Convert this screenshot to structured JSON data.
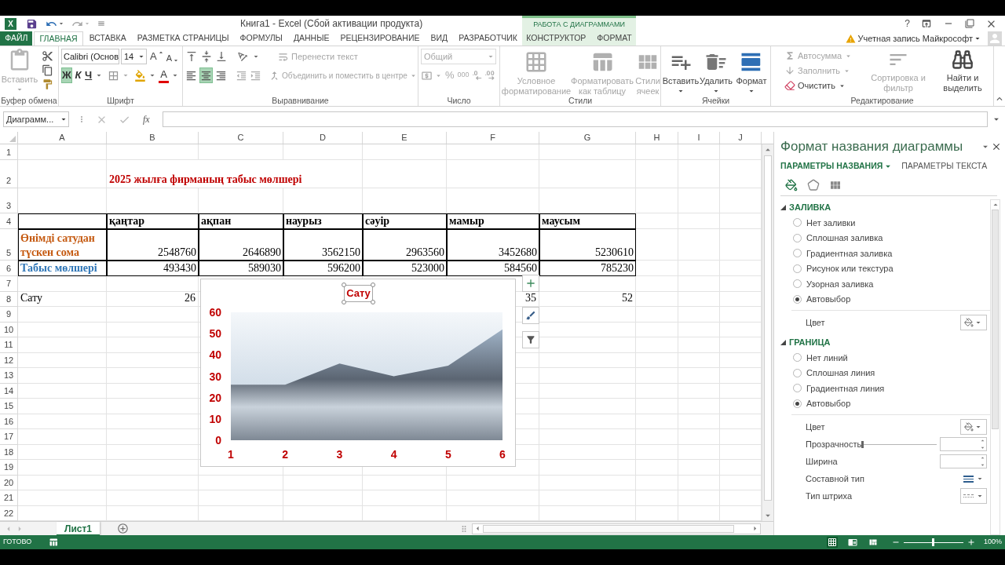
{
  "window": {
    "logo": "X",
    "title": "Книга1 - Excel (Сбой активации продукта)",
    "help": "?"
  },
  "context_group": {
    "label": "РАБОТА С ДИАГРАММАМИ"
  },
  "ribbon_tabs": [
    {
      "label": "ФАЙЛ",
      "kind": "file",
      "selected": false
    },
    {
      "label": "ГЛАВНАЯ",
      "kind": "main",
      "selected": true
    },
    {
      "label": "ВСТАВКА",
      "kind": "main",
      "selected": false
    },
    {
      "label": "РАЗМЕТКА СТРАНИЦЫ",
      "kind": "main",
      "selected": false
    },
    {
      "label": "ФОРМУЛЫ",
      "kind": "main",
      "selected": false
    },
    {
      "label": "ДАННЫЕ",
      "kind": "main",
      "selected": false
    },
    {
      "label": "РЕЦЕНЗИРОВАНИЕ",
      "kind": "main",
      "selected": false
    },
    {
      "label": "ВИД",
      "kind": "main",
      "selected": false
    },
    {
      "label": "РАЗРАБОТЧИК",
      "kind": "main",
      "selected": false
    },
    {
      "label": "КОНСТРУКТОР",
      "kind": "contextual",
      "selected": false
    },
    {
      "label": "ФОРМАТ",
      "kind": "contextual",
      "selected": false
    }
  ],
  "account": {
    "label": "Учетная запись Майкрософт"
  },
  "ribbon_groups": [
    {
      "kind": "clipboard",
      "label": "Буфер обмена",
      "paste": {
        "label": "Вставить",
        "disabled": true
      }
    },
    {
      "kind": "font",
      "label": "Шрифт",
      "font_name": "Calibri (Основ",
      "font_size": "14",
      "grow": "A",
      "shrink": "A",
      "bold": {
        "glyph": "Ж",
        "selected": true
      },
      "italic": {
        "glyph": "К",
        "selected": false
      },
      "underline": {
        "glyph": "Ч",
        "selected": false
      },
      "font_color": "A"
    },
    {
      "kind": "alignment",
      "label": "Выравнивание",
      "wrap_text": {
        "label": "Перенести текст",
        "disabled": true
      },
      "merge": {
        "label": "Объединить и поместить в центре",
        "disabled": true
      },
      "align": [
        {
          "selected": false
        },
        {
          "selected": true
        },
        {
          "selected": false
        }
      ]
    },
    {
      "kind": "number",
      "label": "Число",
      "format": {
        "value": "Общий",
        "disabled": true
      },
      "percent": "%",
      "thousands": "000"
    },
    {
      "kind": "styles",
      "label": "Стили",
      "buttons": [
        {
          "label": "Условное форматирование",
          "disabled": true
        },
        {
          "label": "Форматировать как таблицу",
          "disabled": true
        },
        {
          "label": "Стили ячеек",
          "disabled": true
        }
      ]
    },
    {
      "kind": "cells",
      "label": "Ячейки",
      "buttons": [
        {
          "label": "Вставить",
          "disabled": false
        },
        {
          "label": "Удалить",
          "disabled": false
        },
        {
          "label": "Формат",
          "disabled": false
        }
      ]
    },
    {
      "kind": "editing",
      "label": "Редактирование",
      "small": [
        {
          "label": "Автосумма",
          "disabled": true
        },
        {
          "label": "Заполнить",
          "disabled": true
        },
        {
          "label": "Очистить",
          "disabled": false
        }
      ],
      "buttons": [
        {
          "label": "Сортировка и фильтр",
          "disabled": true
        },
        {
          "label": "Найти и выделить",
          "disabled": false
        }
      ]
    }
  ],
  "formula_bar": {
    "name_box": "Диаграмм...",
    "fx": "fx"
  },
  "sheet": {
    "columns": [
      "A",
      "B",
      "C",
      "D",
      "E",
      "F",
      "G",
      "H",
      "I",
      "J"
    ],
    "rows": [
      {
        "number": "1"
      },
      {
        "number": "2",
        "cells": [
          {},
          {
            "text": "2025 жылға фирманың табыс мөлшері",
            "kind": "text",
            "bold": true,
            "bordered": false,
            "color": "#c00000"
          }
        ]
      },
      {
        "number": "3"
      },
      {
        "number": "4",
        "cells": [
          {
            "bordered": true
          },
          {
            "text": "қаңтар",
            "kind": "text",
            "bold": true,
            "bordered": true
          },
          {
            "text": "ақпан",
            "kind": "text",
            "bold": true,
            "bordered": true
          },
          {
            "text": "наурыз",
            "kind": "text",
            "bold": true,
            "bordered": true
          },
          {
            "text": "сәуір",
            "kind": "text",
            "bold": true,
            "bordered": true
          },
          {
            "text": "мамыр",
            "kind": "text",
            "bold": true,
            "bordered": true
          },
          {
            "text": "маусым",
            "kind": "text",
            "bold": true,
            "bordered": true
          }
        ]
      },
      {
        "number": "5",
        "cells": [
          {
            "text": "Өнімді сатудан түскен сома",
            "kind": "text",
            "bold": true,
            "wrapped": true,
            "bordered": true,
            "color": "#c55a11"
          },
          {
            "text": "2548760",
            "kind": "number",
            "bold": false,
            "bordered": true
          },
          {
            "text": "2646890",
            "kind": "number",
            "bold": false,
            "bordered": true
          },
          {
            "text": "3562150",
            "kind": "number",
            "bold": false,
            "bordered": true
          },
          {
            "text": "2963560",
            "kind": "number",
            "bold": false,
            "bordered": true
          },
          {
            "text": "3452680",
            "kind": "number",
            "bold": false,
            "bordered": true
          },
          {
            "text": "5230610",
            "kind": "number",
            "bold": false,
            "bordered": true
          }
        ]
      },
      {
        "number": "6",
        "cells": [
          {
            "text": "Табыс мөлшері",
            "kind": "text",
            "bold": true,
            "bordered": true,
            "color": "#2e75b6"
          },
          {
            "text": "493430",
            "kind": "number",
            "bold": false,
            "bordered": true
          },
          {
            "text": "589030",
            "kind": "number",
            "bold": false,
            "bordered": true
          },
          {
            "text": "596200",
            "kind": "number",
            "bold": false,
            "bordered": true
          },
          {
            "text": "523000",
            "kind": "number",
            "bold": false,
            "bordered": true
          },
          {
            "text": "584560",
            "kind": "number",
            "bold": false,
            "bordered": true
          },
          {
            "text": "785230",
            "kind": "number",
            "bold": false,
            "bordered": true
          }
        ]
      },
      {
        "number": "7"
      },
      {
        "number": "8",
        "cells": [
          {
            "text": "Сату",
            "kind": "text",
            "bold": false,
            "bordered": false
          },
          {
            "text": "26",
            "kind": "number",
            "bold": false,
            "bordered": false
          },
          {},
          {},
          {},
          {
            "text": "35",
            "kind": "number",
            "bold": false,
            "bordered": false
          },
          {
            "text": "52",
            "kind": "number",
            "bold": false,
            "bordered": false
          }
        ]
      },
      {
        "number": "9"
      },
      {
        "number": "10"
      },
      {
        "number": "11"
      },
      {
        "number": "12"
      },
      {
        "number": "13"
      },
      {
        "number": "14"
      },
      {
        "number": "15"
      },
      {
        "number": "16"
      },
      {
        "number": "17"
      },
      {
        "number": "18"
      },
      {
        "number": "19"
      },
      {
        "number": "20"
      },
      {
        "number": "21"
      },
      {
        "number": "22"
      }
    ]
  },
  "chart": {
    "chart_data": {
      "type": "area",
      "title": "Сату",
      "categories": [
        "1",
        "2",
        "3",
        "4",
        "5",
        "6"
      ],
      "values": [
        26,
        26,
        36,
        30,
        35,
        52
      ],
      "ylim": [
        0,
        60
      ],
      "yticks": [
        0,
        10,
        20,
        30,
        40,
        50,
        60
      ]
    }
  },
  "format_pane": {
    "title": "Формат названия диаграммы",
    "tabs": [
      {
        "label": "ПАРАМЕТРЫ НАЗВАНИЯ",
        "selected": true
      },
      {
        "label": "ПАРАМЕТРЫ ТЕКСТА",
        "selected": false
      }
    ],
    "icon_tabs": [
      {
        "selected": true
      },
      {
        "selected": false
      },
      {
        "selected": false
      }
    ],
    "sections": [
      {
        "title": "ЗАЛИВКА",
        "expanded": true,
        "options": [
          {
            "label": "Нет заливки",
            "selected": false
          },
          {
            "label": "Сплошная заливка",
            "selected": false
          },
          {
            "label": "Градиентная заливка",
            "selected": false
          },
          {
            "label": "Рисунок или текстура",
            "selected": false
          },
          {
            "label": "Узорная заливка",
            "selected": false
          },
          {
            "label": "Автовыбор",
            "selected": true
          }
        ],
        "settings": [
          {
            "kind": "color",
            "label": "Цвет"
          }
        ]
      },
      {
        "title": "ГРАНИЦА",
        "expanded": true,
        "options": [
          {
            "label": "Нет линий",
            "selected": false
          },
          {
            "label": "Сплошная линия",
            "selected": false
          },
          {
            "label": "Градиентная линия",
            "selected": false
          },
          {
            "label": "Автовыбор",
            "selected": true
          }
        ],
        "settings": [
          {
            "kind": "color",
            "label": "Цвет"
          },
          {
            "kind": "slider",
            "label": "Прозрачность",
            "level": 0
          },
          {
            "kind": "spin",
            "label": "Ширина"
          },
          {
            "kind": "compound",
            "label": "Составной тип"
          },
          {
            "kind": "dash",
            "label": "Тип штриха"
          }
        ]
      }
    ]
  },
  "sheet_tabs": [
    {
      "label": "Лист1",
      "selected": true
    }
  ],
  "status_bar": {
    "status": "ГОТОВО",
    "views": [
      {
        "selected": true
      },
      {
        "selected": false
      },
      {
        "selected": false
      }
    ],
    "zoom_slider": {
      "level": 0.5
    },
    "zoom": "100%"
  }
}
